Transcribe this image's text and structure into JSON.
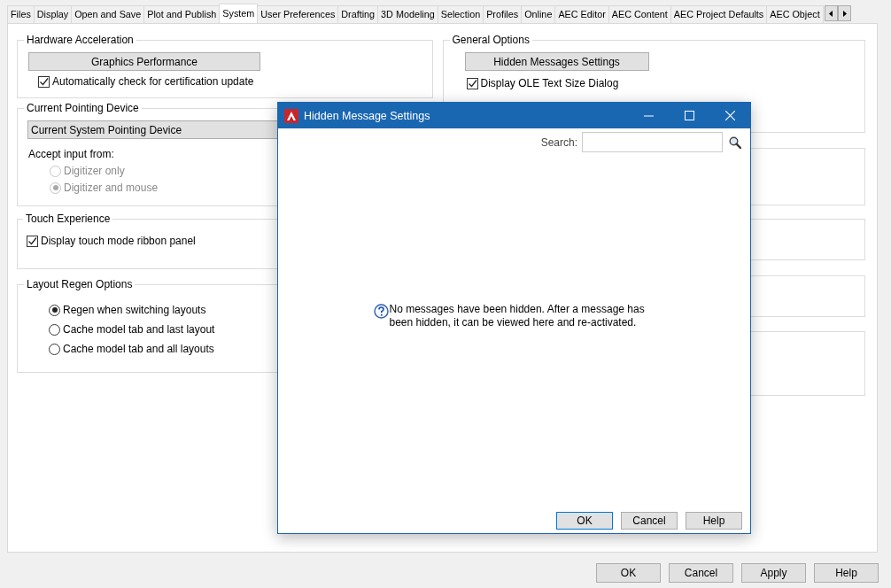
{
  "tabs": [
    {
      "label": "Files",
      "selected": false
    },
    {
      "label": "Display",
      "selected": false
    },
    {
      "label": "Open and Save",
      "selected": false
    },
    {
      "label": "Plot and Publish",
      "selected": false
    },
    {
      "label": "System",
      "selected": true
    },
    {
      "label": "User Preferences",
      "selected": false
    },
    {
      "label": "Drafting",
      "selected": false
    },
    {
      "label": "3D Modeling",
      "selected": false
    },
    {
      "label": "Selection",
      "selected": false
    },
    {
      "label": "Profiles",
      "selected": false
    },
    {
      "label": "Online",
      "selected": false
    },
    {
      "label": "AEC Editor",
      "selected": false
    },
    {
      "label": "AEC Content",
      "selected": false
    },
    {
      "label": "AEC Project Defaults",
      "selected": false
    },
    {
      "label": "AEC Object",
      "selected": false
    }
  ],
  "left_column": [
    {
      "title": "Hardware Acceleration",
      "items": [
        {
          "kind": "button",
          "label": "Graphics Performance"
        },
        {
          "kind": "checkbox",
          "label": "Automatically check for certification update",
          "checked": true
        }
      ]
    },
    {
      "title": "Current Pointing Device",
      "items": [
        {
          "kind": "list",
          "label": "Current System Pointing Device"
        },
        {
          "kind": "text",
          "label": "Accept input from:"
        },
        {
          "kind": "radio",
          "label": "Digitizer only",
          "selected": false,
          "disabled": true
        },
        {
          "kind": "radio",
          "label": "Digitizer and mouse",
          "selected": true,
          "disabled": true
        }
      ]
    },
    {
      "title": "Touch Experience",
      "items": [
        {
          "kind": "checkbox",
          "label": "Display touch mode ribbon panel",
          "checked": true
        }
      ]
    },
    {
      "title": "Layout Regen Options",
      "items": [
        {
          "kind": "radio",
          "label": "Regen when switching layouts",
          "selected": true,
          "disabled": false
        },
        {
          "kind": "radio",
          "label": "Cache model tab and last layout",
          "selected": false,
          "disabled": false
        },
        {
          "kind": "radio",
          "label": "Cache model tab and all layouts",
          "selected": false,
          "disabled": false
        }
      ]
    }
  ],
  "right_column": [
    {
      "kind": "group",
      "title": "General Options",
      "items": [
        {
          "kind": "button",
          "label": "Hidden Messages Settings"
        },
        {
          "kind": "checkbox",
          "label": "Display OLE Text Size Dialog",
          "checked": true
        }
      ]
    },
    {
      "kind": "group"
    },
    {
      "kind": "group"
    },
    {
      "kind": "group"
    },
    {
      "kind": "group"
    }
  ],
  "buttons": [
    {
      "label": "OK"
    },
    {
      "label": "Cancel"
    },
    {
      "label": "Apply"
    },
    {
      "label": "Help"
    }
  ],
  "dialog": {
    "title": "Hidden Message Settings",
    "search_label": "Search:",
    "message": "No messages have been hidden. After a message has been hidden, it can be viewed here and re-activated.",
    "buttons": [
      {
        "label": "OK",
        "default": true
      },
      {
        "label": "Cancel",
        "default": false
      },
      {
        "label": "Help",
        "default": false
      }
    ]
  }
}
